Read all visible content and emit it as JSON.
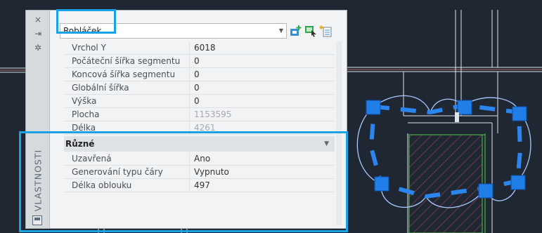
{
  "palette": {
    "title": "VLASTNOSTI",
    "rail_buttons": {
      "close": "×",
      "pin": "⇥",
      "settings": "✲"
    }
  },
  "object_select": {
    "value": "Robláček"
  },
  "properties": {
    "rows": [
      {
        "label": "Vrchol Y",
        "value": "6018",
        "readonly": false
      },
      {
        "label": "Počáteční šířka segmentu",
        "value": "0",
        "readonly": false
      },
      {
        "label": "Koncová šířka segmentu",
        "value": "0",
        "readonly": false
      },
      {
        "label": "Globální šířka",
        "value": "0",
        "readonly": false
      },
      {
        "label": "Výška",
        "value": "0",
        "readonly": false
      },
      {
        "label": "Plocha",
        "value": "1153595",
        "readonly": true
      },
      {
        "label": "Délka",
        "value": "4261",
        "readonly": true
      }
    ],
    "misc_group": {
      "title": "Různé",
      "rows": [
        {
          "label": "Uzavřená",
          "value": "Ano"
        },
        {
          "label": "Generování typu čáry",
          "value": "Vypnuto"
        },
        {
          "label": "Délka oblouku",
          "value": "497"
        }
      ]
    }
  },
  "colors": {
    "canvas": "#1f2733",
    "highlight": "#1aa1e6",
    "grip": "#1f7ee8",
    "cloud": "#9ec6ff",
    "wall": "#dfe3e8"
  }
}
